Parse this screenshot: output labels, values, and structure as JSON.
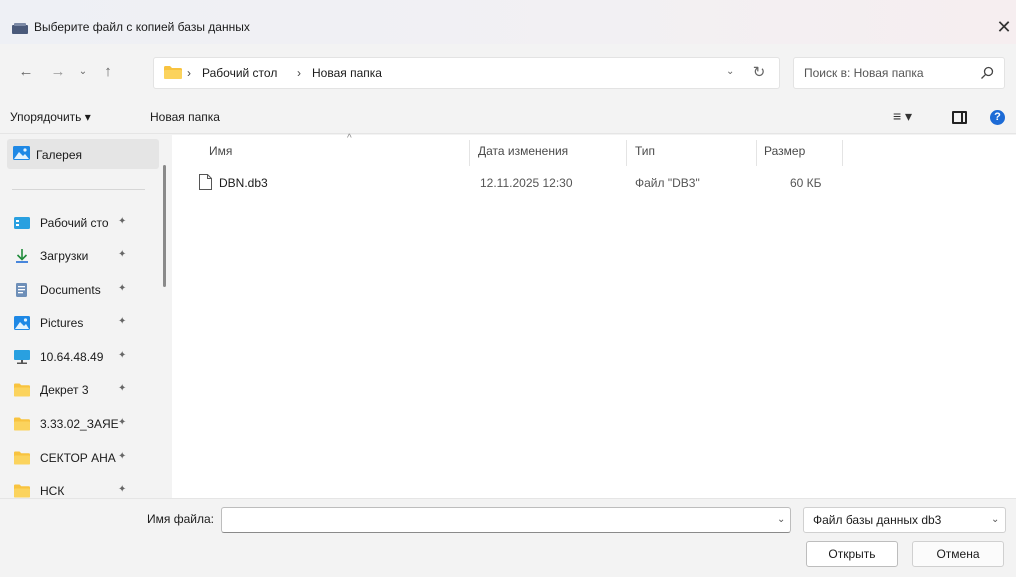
{
  "window": {
    "title": "Выберите файл с копией базы данных",
    "close_glyph": "✕"
  },
  "navigation": {
    "back": "←",
    "forward": "→",
    "history": "⌄",
    "up": "↑",
    "refresh": "↻"
  },
  "address": {
    "separator": "›",
    "breadcrumbs": [
      "Рабочий стол",
      "Новая папка"
    ],
    "dropdown": "⌄"
  },
  "search": {
    "placeholder": "Поиск в: Новая папка",
    "value": ""
  },
  "toolbar": {
    "organize": "Упорядочить ▾",
    "new_folder": "Новая папка",
    "view": "≡ ▾",
    "help": "?"
  },
  "nav_pane": {
    "gallery": "Галерея",
    "items": [
      {
        "label": "Рабочий сто",
        "icon": "desktop-icon"
      },
      {
        "label": "Загрузки",
        "icon": "downloads-icon"
      },
      {
        "label": "Documents",
        "icon": "documents-icon"
      },
      {
        "label": "Pictures",
        "icon": "pictures-icon"
      },
      {
        "label": "10.64.48.49",
        "icon": "network-drive-icon"
      },
      {
        "label": "Декрет 3",
        "icon": "folder-icon"
      },
      {
        "label": "3.33.02_ЗАЯЕ",
        "icon": "folder-icon"
      },
      {
        "label": "СЕКТОР АНА",
        "icon": "folder-icon"
      },
      {
        "label": "НСК",
        "icon": "folder-icon"
      }
    ],
    "pin_glyph": "✦"
  },
  "file_list": {
    "columns": [
      "Имя",
      "Дата изменения",
      "Тип",
      "Размер"
    ],
    "sort_glyph": "^",
    "rows": [
      {
        "name": "DBN.db3",
        "modified": "12.11.2025 12:30",
        "type": "Файл \"DB3\"",
        "size": "60 КБ"
      }
    ]
  },
  "footer": {
    "filename_label": "Имя файла:",
    "filename_value": "",
    "dropdown": "⌄",
    "filetype": "Файл базы данных db3",
    "open": "Открыть",
    "cancel": "Отмена"
  },
  "colors": {
    "folder": "#f8c33f",
    "accent": "#1d6bd6"
  }
}
